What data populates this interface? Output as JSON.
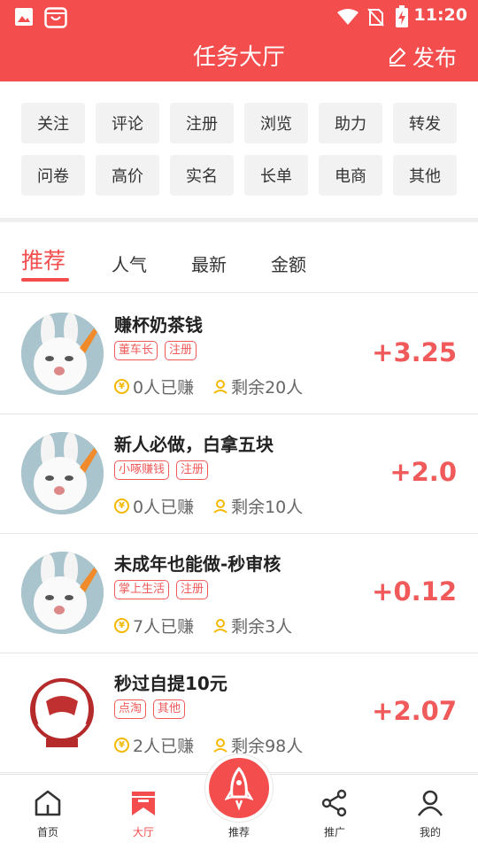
{
  "status_bar": {
    "time": "11:20"
  },
  "header": {
    "title": "任务大厅",
    "publish_label": "发布"
  },
  "categories": [
    "关注",
    "评论",
    "注册",
    "浏览",
    "助力",
    "转发",
    "问卷",
    "高价",
    "实名",
    "长单",
    "电商",
    "其他"
  ],
  "tabs": [
    {
      "label": "推荐",
      "active": true
    },
    {
      "label": "人气",
      "active": false
    },
    {
      "label": "最新",
      "active": false
    },
    {
      "label": "金额",
      "active": false
    }
  ],
  "tasks": [
    {
      "title": "赚杯奶茶钱",
      "tags": [
        "董车长",
        "注册"
      ],
      "earned": "0人已赚",
      "remaining": "剩余20人",
      "amount": "+3.25",
      "avatar": "rabbit-avatar"
    },
    {
      "title": "新人必做，白拿五块",
      "tags": [
        "小啄赚钱",
        "注册"
      ],
      "earned": "0人已赚",
      "remaining": "剩余10人",
      "amount": "+2.0",
      "avatar": "rabbit-avatar"
    },
    {
      "title": "未成年也能做-秒审核",
      "tags": [
        "掌上生活",
        "注册"
      ],
      "earned": "7人已赚",
      "remaining": "剩余3人",
      "amount": "+0.12",
      "avatar": "rabbit-avatar"
    },
    {
      "title": "秒过自提10元",
      "tags": [
        "点淘",
        "其他"
      ],
      "earned": "2人已赚",
      "remaining": "剩余98人",
      "amount": "+2.07",
      "avatar": "seal-logo"
    }
  ],
  "coin_glyph": "¥",
  "nav": [
    {
      "label": "首页",
      "icon": "home-icon",
      "active": false
    },
    {
      "label": "大厅",
      "icon": "bookmark-icon",
      "active": true
    },
    {
      "label": "推荐",
      "icon": "rocket-icon",
      "active": false
    },
    {
      "label": "推广",
      "icon": "share-icon",
      "active": false
    },
    {
      "label": "我的",
      "icon": "user-icon",
      "active": false
    }
  ],
  "colors": {
    "accent": "#f34d4d",
    "tag": "#f05a5a",
    "coin": "#f5b800"
  }
}
